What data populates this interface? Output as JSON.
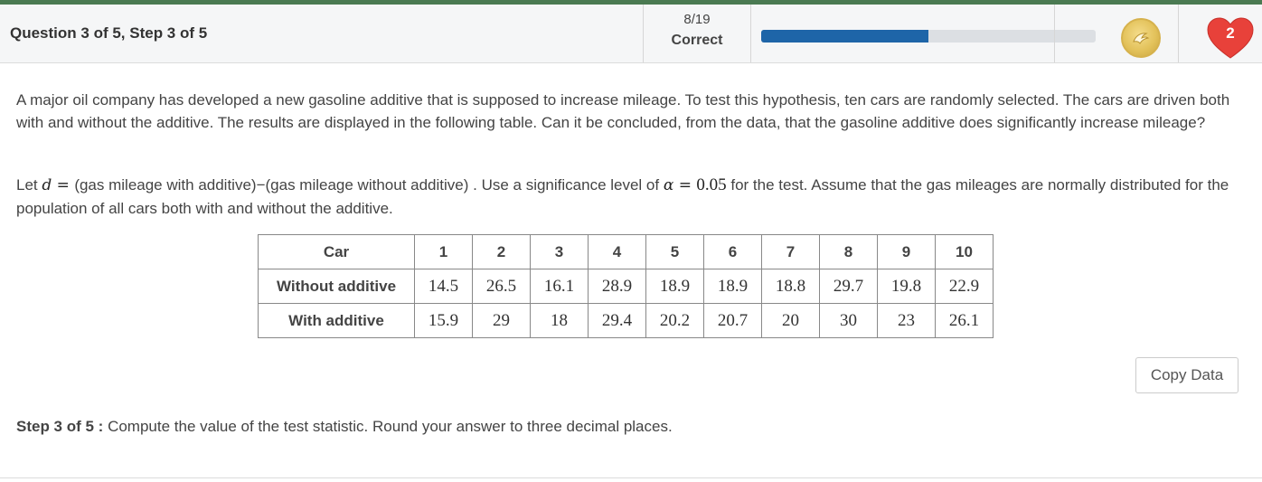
{
  "header": {
    "question_title": "Question 3 of 5, Step 3 of 5",
    "score_fraction": "8/19",
    "score_status": "Correct",
    "progress": 0.5,
    "progress_color": "#1e65a8",
    "coin_icon": "coin-icon",
    "heart_icon": "heart-icon",
    "hearts_count": "2"
  },
  "problem": {
    "intro": "A major oil company has developed a new gasoline additive that is supposed to increase mileage.  To test this hypothesis, ten cars are randomly selected.  The cars are driven both with and without the additive.  The results are displayed in the following table.  Can it be concluded, from the data, that the gasoline additive does significantly increase mileage?",
    "let_prefix": "Let ",
    "let_var": "d",
    "let_eq": " = ",
    "let_def": " (gas mileage with additive)−(gas mileage without additive) .  Use a significance level of ",
    "alpha_sym": "α",
    "alpha_eq": " = ",
    "alpha_val": "0.05",
    "let_suffix": " for the test.  Assume that the gas mileages are normally distributed for the population of all cars both with and without the additive."
  },
  "table": {
    "header_label": "Car",
    "cars": [
      "1",
      "2",
      "3",
      "4",
      "5",
      "6",
      "7",
      "8",
      "9",
      "10"
    ],
    "row1_label": "Without additive",
    "row1": [
      "14.5",
      "26.5",
      "16.1",
      "28.9",
      "18.9",
      "18.9",
      "18.8",
      "29.7",
      "19.8",
      "22.9"
    ],
    "row2_label": "With additive",
    "row2": [
      "15.9",
      "29",
      "18",
      "29.4",
      "20.2",
      "20.7",
      "20",
      "30",
      "23",
      "26.1"
    ]
  },
  "copy_button": "Copy Data",
  "step": {
    "label": "Step 3 of 5 : ",
    "text": "Compute the value of the test statistic. Round your answer to three decimal places."
  }
}
